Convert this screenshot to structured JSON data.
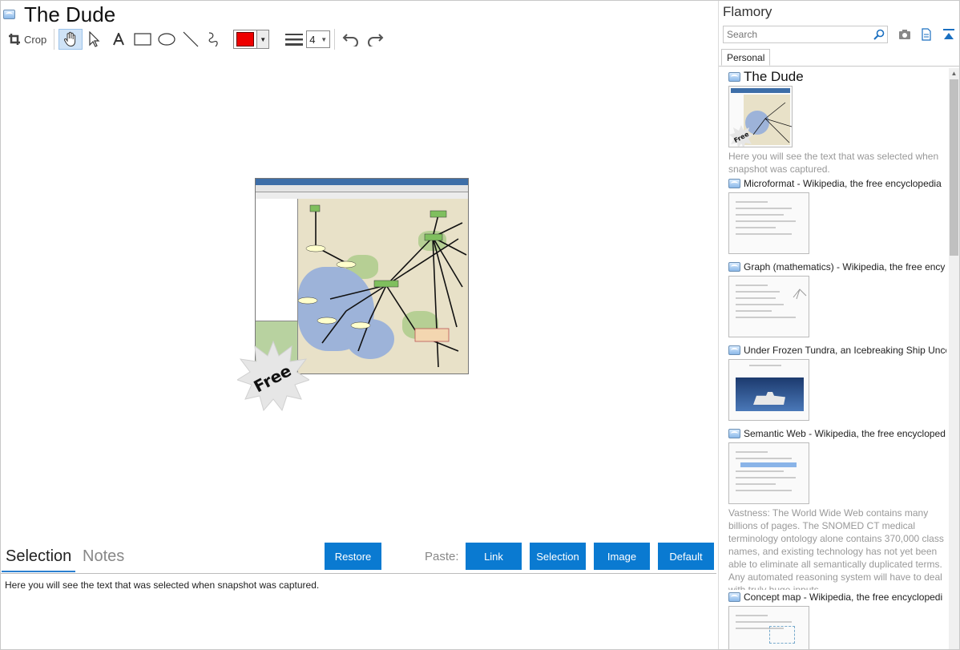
{
  "window": {
    "title": "The Dude"
  },
  "toolbar": {
    "crop_label": "Crop",
    "color": "#ee0000",
    "line_width": "4"
  },
  "canvas": {
    "badge_text": "Free"
  },
  "bottom": {
    "tabs": [
      {
        "label": "Selection"
      },
      {
        "label": "Notes"
      }
    ],
    "restore_label": "Restore",
    "paste_label": "Paste:",
    "paste_buttons": [
      {
        "label": "Link"
      },
      {
        "label": "Selection"
      },
      {
        "label": "Image"
      },
      {
        "label": "Default"
      }
    ],
    "selection_text": "Here you will see the text that was selected when snapshot was captured."
  },
  "sidebar": {
    "app_name": "Flamory",
    "search_placeholder": "Search",
    "tab_label": "Personal",
    "items": [
      {
        "title": "The Dude",
        "thumb_badge": "Free",
        "desc": "Here you will see the text that was selected when snapshot was captured."
      },
      {
        "title": "Microformat - Wikipedia, the free encyclopedia"
      },
      {
        "title": "Graph (mathematics) - Wikipedia, the free ency"
      },
      {
        "title": "Under Frozen Tundra, an Icebreaking Ship Unco"
      },
      {
        "title": "Semantic Web - Wikipedia, the free encycloped",
        "desc": "Vastness: The World Wide Web contains many billions of pages. The SNOMED CT medical terminology ontology alone contains 370,000 class names, and existing technology has not yet been able to eliminate all semantically duplicated terms. Any automated reasoning system will have to deal with truly huge inputs."
      },
      {
        "title": "Concept map - Wikipedia, the free encyclopedi"
      }
    ]
  },
  "colors": {
    "accent": "#0a7ad1",
    "tab_underline": "#2a7fd0"
  }
}
